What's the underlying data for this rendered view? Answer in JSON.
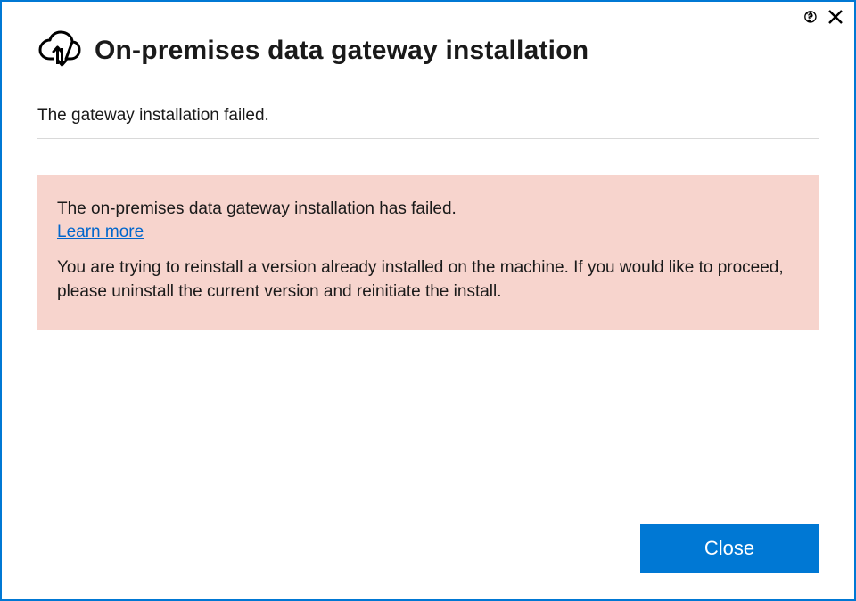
{
  "header": {
    "title": "On-premises data gateway installation"
  },
  "status_line": "The gateway installation failed.",
  "error": {
    "heading": "The on-premises data gateway installation has failed.",
    "learn_more_label": "Learn more",
    "body": "You are trying to reinstall a version already installed on the machine. If you would like to proceed, please uninstall the current version and reinitiate the install."
  },
  "footer": {
    "close_label": "Close"
  }
}
